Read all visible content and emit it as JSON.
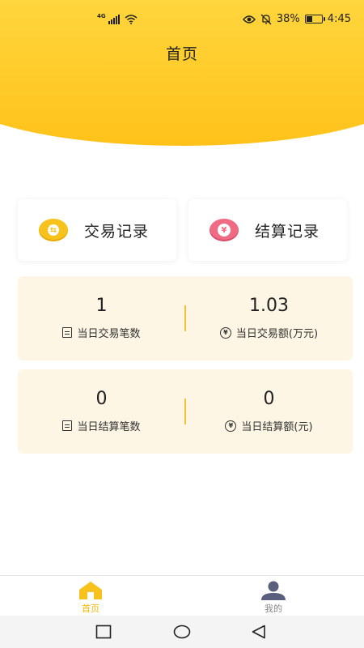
{
  "status_bar": {
    "network": "4G",
    "battery_percent": "38%",
    "time": "4:45",
    "icons": [
      "signal-icon",
      "wifi-icon",
      "eye-icon",
      "mute-bell-icon",
      "battery-icon"
    ]
  },
  "header": {
    "title": "首页"
  },
  "actions": [
    {
      "label": "交易记录",
      "icon": "exchange-coin-icon",
      "icon_color": "#f7c21c"
    },
    {
      "label": "结算记录",
      "icon": "yen-coin-icon",
      "icon_color": "#f06a84"
    }
  ],
  "stats": [
    {
      "left": {
        "value": "1",
        "label": "当日交易笔数",
        "icon": "document-icon"
      },
      "right": {
        "value": "1.03",
        "label": "当日交易额(万元)",
        "icon": "yen-circle-icon"
      }
    },
    {
      "left": {
        "value": "0",
        "label": "当日结算笔数",
        "icon": "document-icon"
      },
      "right": {
        "value": "0",
        "label": "当日结算额(元)",
        "icon": "yen-circle-icon"
      }
    }
  ],
  "bottom_nav": [
    {
      "label": "首页",
      "icon": "home-icon",
      "active": true
    },
    {
      "label": "我的",
      "icon": "user-icon",
      "active": false
    }
  ],
  "colors": {
    "accent": "#f7c21c",
    "header_gradient_top": "#ffe35a",
    "header_gradient_bottom": "#ffc21a",
    "panel_bg": "#fdf6e4",
    "active_tab": "#f2b705",
    "inactive_tab": "#888888",
    "user_icon": "#5a5f7d"
  }
}
